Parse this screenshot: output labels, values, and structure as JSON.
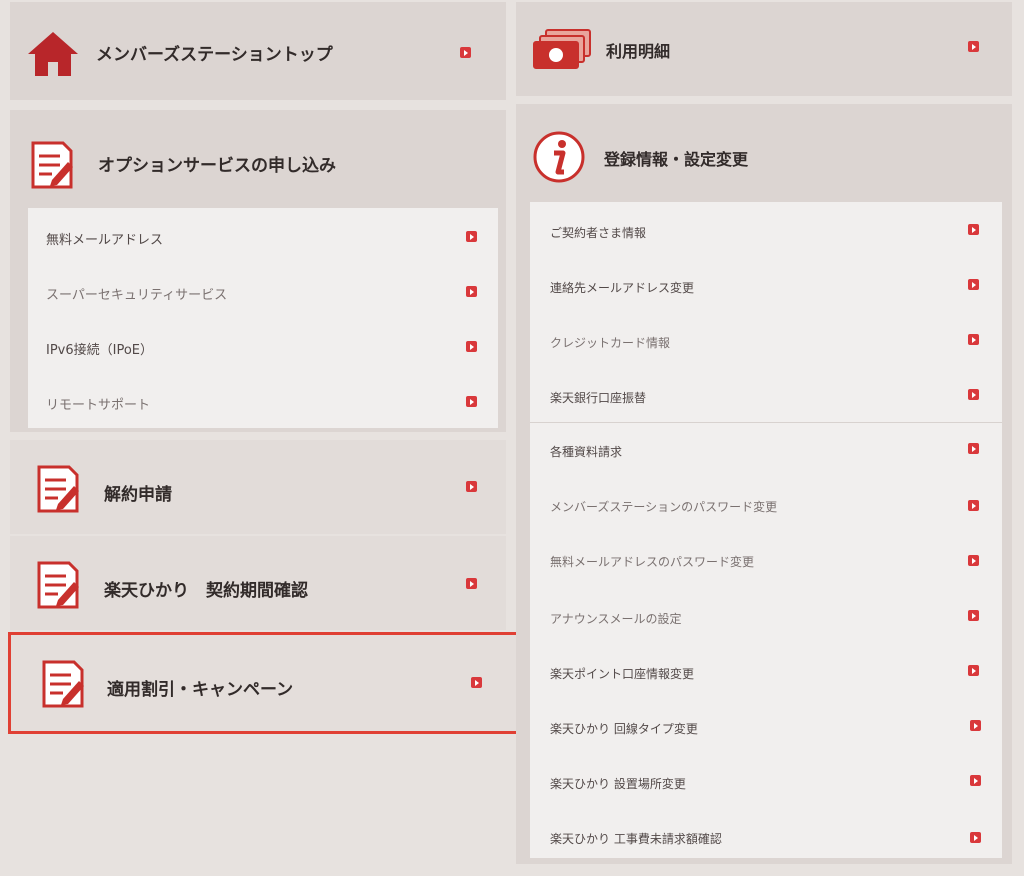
{
  "left": {
    "top_link": {
      "label": "メンバーズステーショントップ",
      "icon": "home-icon"
    },
    "options": {
      "title": "オプションサービスの申し込み",
      "icon": "document-edit-icon",
      "items": [
        {
          "label": "無料メールアドレス"
        },
        {
          "label": "スーパーセキュリティサービス"
        },
        {
          "label": "IPv6接続（IPoE）"
        },
        {
          "label": "リモートサポート"
        }
      ]
    },
    "cancel": {
      "label": "解約申請",
      "icon": "document-edit-icon"
    },
    "contract_period": {
      "label": "楽天ひかり　契約期間確認",
      "icon": "document-edit-icon"
    },
    "discount": {
      "label": "適用割引・キャンペーン",
      "icon": "document-edit-icon"
    }
  },
  "right": {
    "usage": {
      "label": "利用明細",
      "icon": "money-icon"
    },
    "registration": {
      "title": "登録情報・設定変更",
      "icon": "info-icon",
      "items": [
        {
          "label": "ご契約者さま情報"
        },
        {
          "label": "連絡先メールアドレス変更"
        },
        {
          "label": "クレジットカード情報"
        },
        {
          "label": "楽天銀行口座振替"
        },
        {
          "label": "各種資料請求"
        },
        {
          "label": "メンバーズステーションのパスワード変更"
        },
        {
          "label": "無料メールアドレスのパスワード変更"
        },
        {
          "label": "アナウンスメールの設定"
        },
        {
          "label": "楽天ポイント口座情報変更"
        },
        {
          "label": "楽天ひかり 回線タイプ変更"
        },
        {
          "label": "楽天ひかり 設置場所変更"
        },
        {
          "label": "楽天ひかり 工事費未請求額確認"
        }
      ]
    }
  },
  "colors": {
    "accent": "#d9383b",
    "highlight": "#e04034"
  }
}
